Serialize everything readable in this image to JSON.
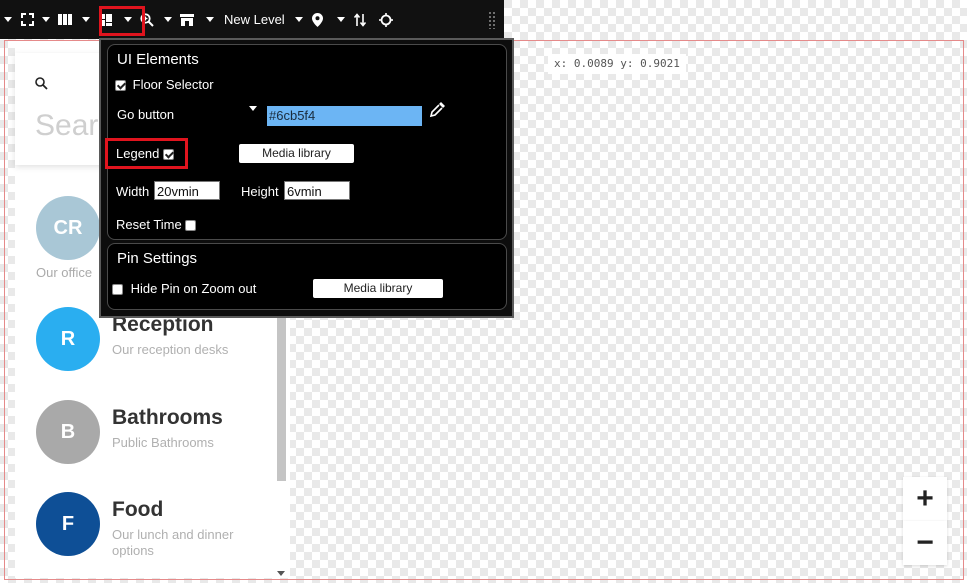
{
  "toolbar": {
    "level_label": "New Level",
    "icons": [
      "fullscreen-icon",
      "columns-icon",
      "layout-icon",
      "zoom-icon",
      "store-icon",
      "pin-icon",
      "swap-icon",
      "target-icon",
      "drag-grip-icon"
    ]
  },
  "coords": {
    "x_label": "x:",
    "x_value": "0.0089",
    "y_label": "y:",
    "y_value": "0.9021"
  },
  "sidebar": {
    "search_placeholder": "Search",
    "categories": [
      {
        "initials": "CR",
        "name": "",
        "description": "Our office",
        "color": "#a9c7d6"
      },
      {
        "initials": "R",
        "name": "Reception",
        "description": "Our reception desks",
        "color": "#2aaef0"
      },
      {
        "initials": "B",
        "name": "Bathrooms",
        "description": "Public Bathrooms",
        "color": "#a9a9a9"
      },
      {
        "initials": "F",
        "name": "Food",
        "description": "Our lunch and dinner options",
        "color": "#0e4f96"
      }
    ]
  },
  "ui_elements": {
    "title": "UI Elements",
    "floor_selector_label": "Floor Selector",
    "floor_selector_checked": true,
    "go_button_label": "Go button",
    "go_button_color": "#6cb5f4",
    "legend_label": "Legend",
    "legend_checked": true,
    "media_library_label": "Media library",
    "width_label": "Width",
    "width_value": "20vmin",
    "height_label": "Height",
    "height_value": "6vmin",
    "reset_time_label": "Reset Time",
    "reset_time_checked": false
  },
  "pin_settings": {
    "title": "Pin Settings",
    "hide_pin_label": "Hide Pin on Zoom out",
    "hide_pin_checked": false,
    "media_library_label": "Media library"
  },
  "zoom": {
    "in_label": "+",
    "out_label": "−"
  },
  "colors": {
    "highlight": "#e0141e",
    "toolbar_bg": "#111111"
  }
}
